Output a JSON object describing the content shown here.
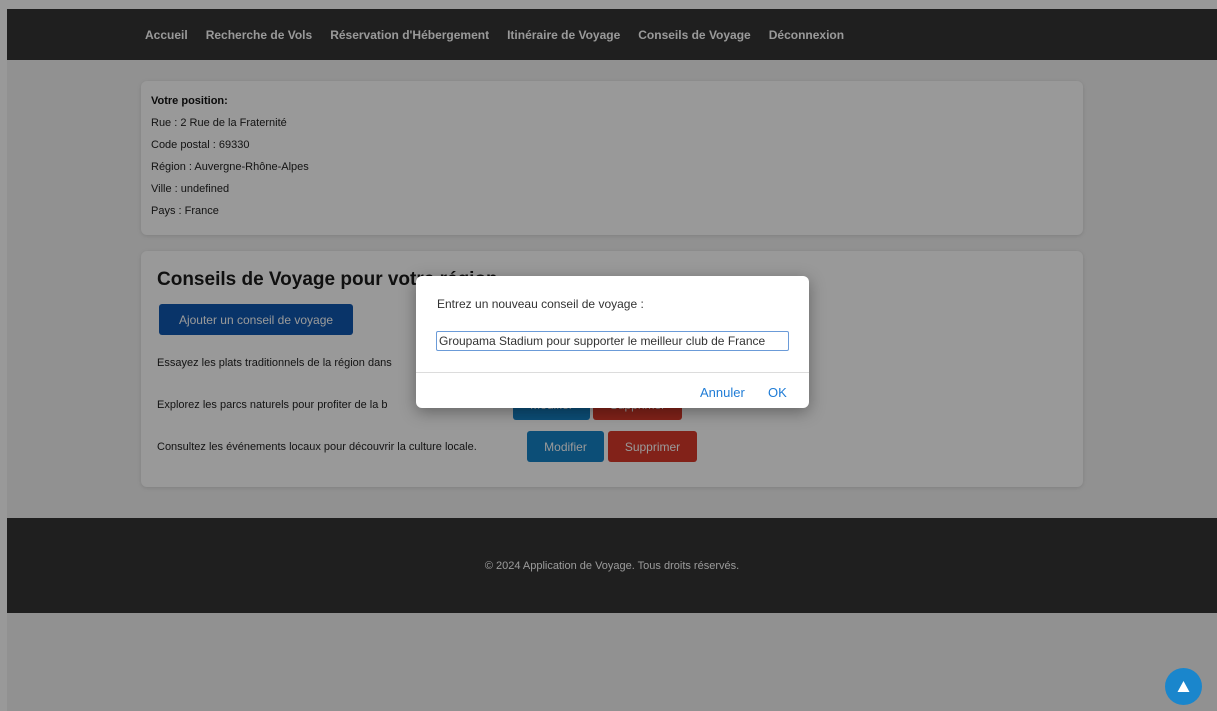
{
  "nav": {
    "items": [
      "Accueil",
      "Recherche de Vols",
      "Réservation d'Hébergement",
      "Itinéraire de Voyage",
      "Conseils de Voyage",
      "Déconnexion"
    ]
  },
  "position": {
    "title": "Votre position:",
    "street": "Rue : 2 Rue de la Fraternité",
    "postal": "Code postal : 69330",
    "region": "Région : Auvergne-Rhône-Alpes",
    "city": "Ville : undefined",
    "country": "Pays : France"
  },
  "tips": {
    "title": "Conseils de Voyage pour votre région",
    "add_label": "Ajouter un conseil de voyage",
    "edit_label": "Modifier",
    "delete_label": "Supprimer",
    "items": [
      "Essayez les plats traditionnels de la région dans",
      "Explorez les parcs naturels pour profiter de la b",
      "Consultez les événements locaux pour découvrir la culture locale."
    ]
  },
  "footer": {
    "text": "© 2024 Application de Voyage. Tous droits réservés."
  },
  "dialog": {
    "message": "Entrez un nouveau conseil de voyage :",
    "input_value": "Groupama Stadium pour supporter le meilleur club de France",
    "cancel_label": "Annuler",
    "ok_label": "OK"
  },
  "scroll_top": {
    "icon": "arrow-up-icon"
  },
  "colors": {
    "navbar": "#343434",
    "add_button": "#1058b0",
    "edit_button": "#1482c7",
    "delete_button": "#d93a2b",
    "dialog_accent": "#1f7cd6"
  }
}
